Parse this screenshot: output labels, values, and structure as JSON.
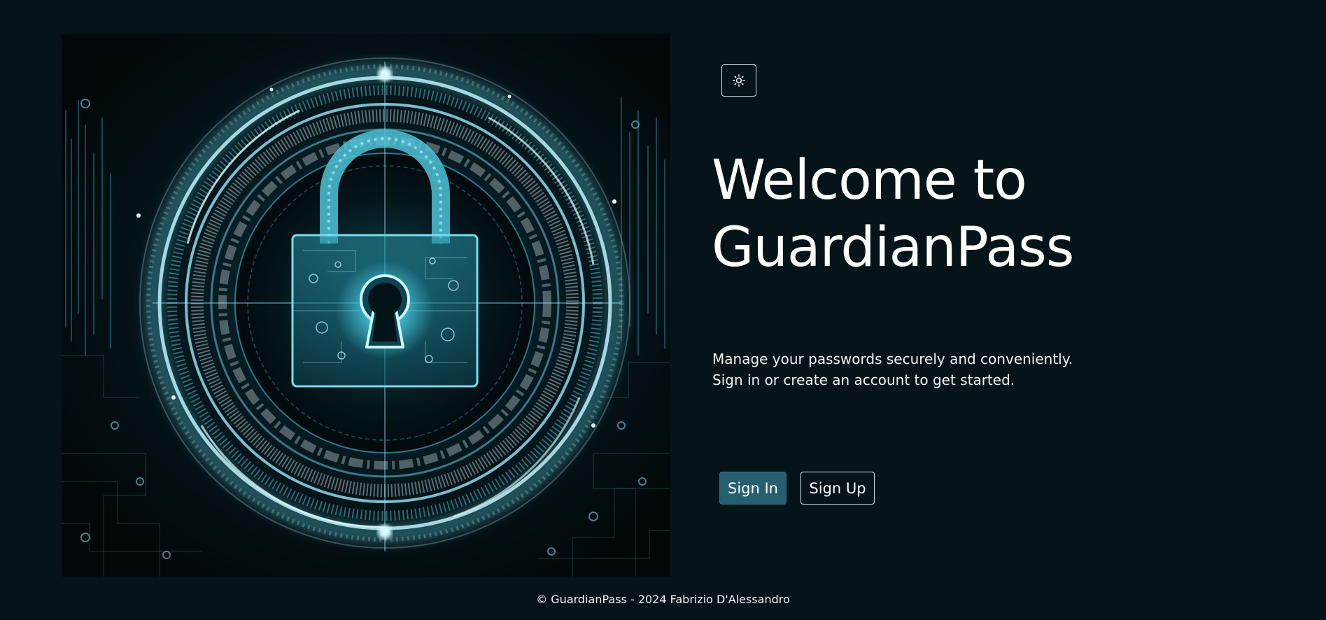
{
  "theme_toggle": {
    "icon": "sun-icon",
    "state": "light-mode-toggle"
  },
  "hero_image": {
    "subject": "glowing padlock with keyhole inside concentric digital rings",
    "accent_color": "#7fe6f5"
  },
  "headline": {
    "line1": "Welcome to",
    "line2": "GuardianPass"
  },
  "tagline": {
    "line1": "Manage your passwords securely and conveniently.",
    "line2": "Sign in or create an account to get started."
  },
  "actions": {
    "sign_in_label": "Sign In",
    "sign_up_label": "Sign Up"
  },
  "footer": {
    "text": "© GuardianPass - 2024 Fabrizio D'Alessandro"
  },
  "colors": {
    "background": "#061419",
    "primary_button": "#255f70",
    "text": "#ffffff",
    "outline": "#d7e2e6"
  }
}
